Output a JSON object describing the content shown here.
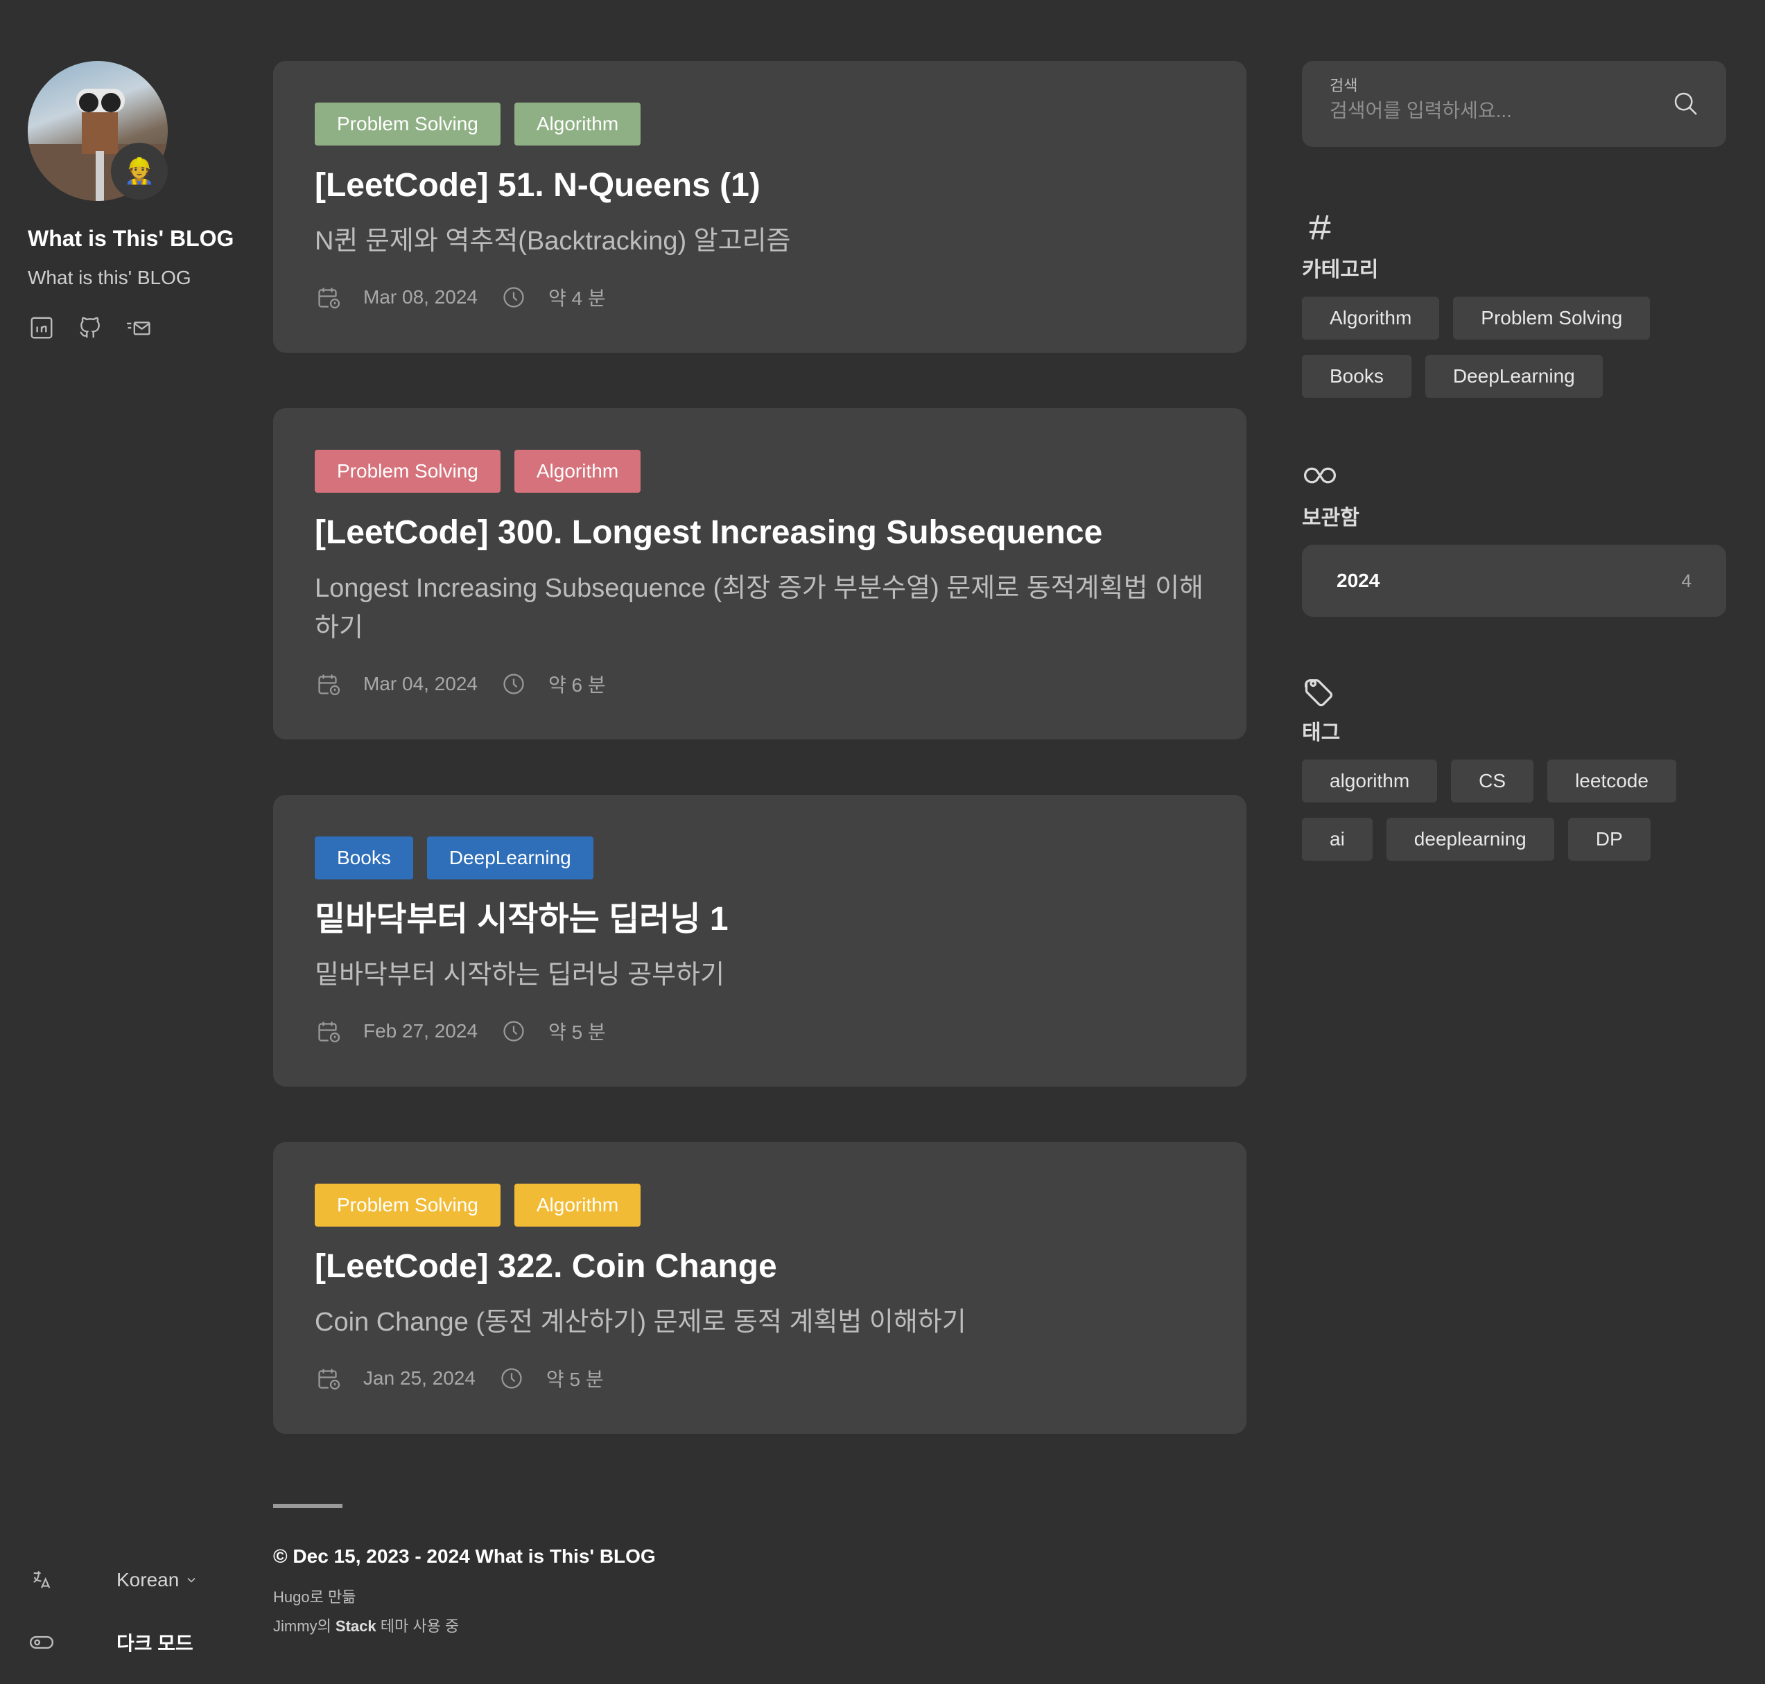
{
  "sidebar": {
    "site_name": "What is This' BLOG",
    "site_description": "What is this' BLOG",
    "avatar_emoji": "👷",
    "social": [
      "linkedin-icon",
      "github-icon",
      "mail-icon"
    ],
    "language_label": "Korean",
    "dark_mode_label": "다크 모드"
  },
  "posts": [
    {
      "categories": [
        {
          "label": "Problem Solving",
          "color": "#8faf84"
        },
        {
          "label": "Algorithm",
          "color": "#8faf84"
        }
      ],
      "title": "[LeetCode] 51. N-Queens (1)",
      "subtitle": "N퀸 문제와 역추적(Backtracking) 알고리즘",
      "date": "Mar 08, 2024",
      "reading_time": "약 4 분"
    },
    {
      "categories": [
        {
          "label": "Problem Solving",
          "color": "#d6727b"
        },
        {
          "label": "Algorithm",
          "color": "#d6727b"
        }
      ],
      "title": "[LeetCode] 300. Longest Increasing Subsequence",
      "subtitle": "Longest Increasing Subsequence (최장 증가 부분수열) 문제로 동적계획법 이해하기",
      "date": "Mar 04, 2024",
      "reading_time": "약 6 분"
    },
    {
      "categories": [
        {
          "label": "Books",
          "color": "#2f6fba"
        },
        {
          "label": "DeepLearning",
          "color": "#2f6fba"
        }
      ],
      "title": "밑바닥부터 시작하는 딥러닝 1",
      "subtitle": "밑바닥부터 시작하는 딥러닝 공부하기",
      "date": "Feb 27, 2024",
      "reading_time": "약 5 분"
    },
    {
      "categories": [
        {
          "label": "Problem Solving",
          "color": "#f2bb35"
        },
        {
          "label": "Algorithm",
          "color": "#f2bb35"
        }
      ],
      "title": "[LeetCode] 322. Coin Change",
      "subtitle": "Coin Change (동전 계산하기) 문제로 동적 계획법 이해하기",
      "date": "Jan 25, 2024",
      "reading_time": "약 5 분"
    }
  ],
  "footer": {
    "copyright": "© Dec 15, 2023 - 2024 What is This' BLOG",
    "powered_hugo": "Hugo로 만듦",
    "theme_prefix": "Jimmy의",
    "theme_name": "Stack",
    "theme_suffix": "테마 사용 중"
  },
  "search": {
    "label": "검색",
    "placeholder": "검색어를 입력하세요..."
  },
  "categories_widget": {
    "title": "카테고리",
    "items": [
      "Algorithm",
      "Problem Solving",
      "Books",
      "DeepLearning"
    ]
  },
  "archives_widget": {
    "title": "보관함",
    "items": [
      {
        "year": "2024",
        "count": "4"
      }
    ]
  },
  "tags_widget": {
    "title": "태그",
    "items": [
      "algorithm",
      "CS",
      "leetcode",
      "ai",
      "deeplearning",
      "DP"
    ]
  }
}
